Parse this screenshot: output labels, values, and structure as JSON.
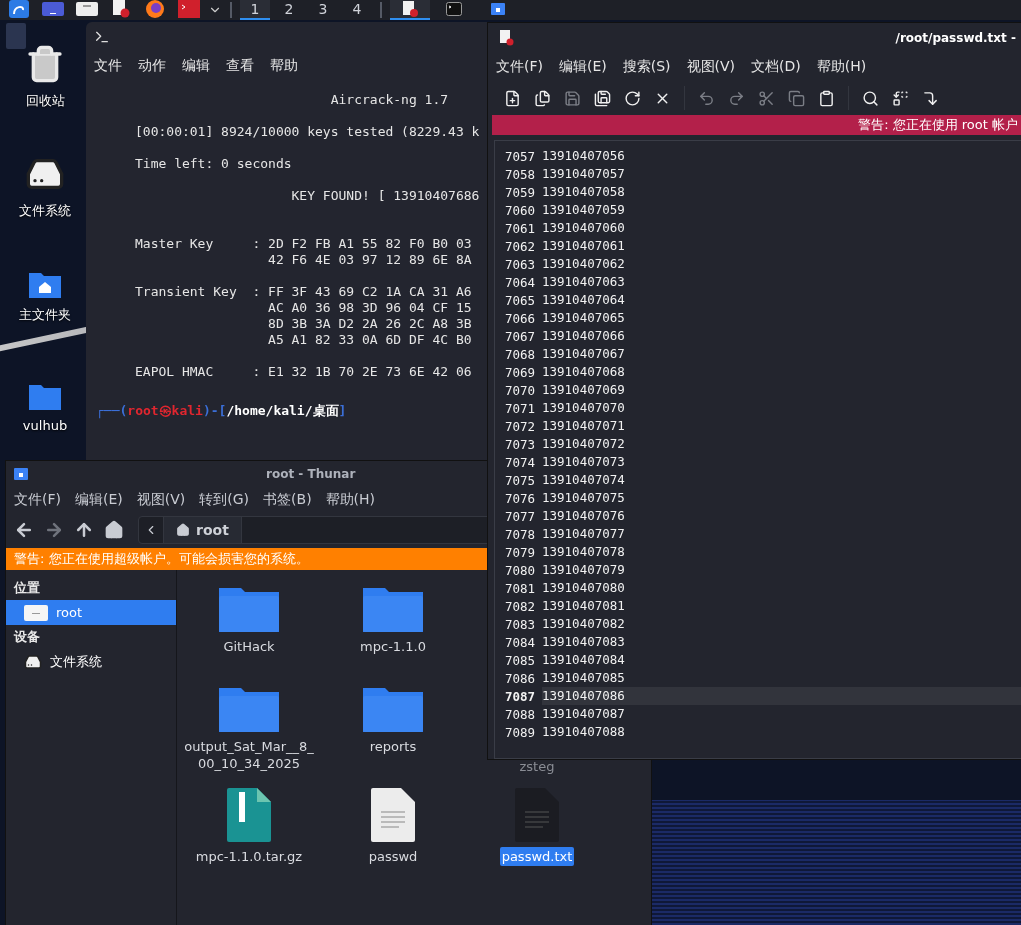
{
  "taskbar": {
    "launchers": [
      {
        "kind": "kali"
      },
      {
        "kind": "window"
      },
      {
        "kind": "folder"
      },
      {
        "kind": "editor"
      },
      {
        "kind": "browser"
      },
      {
        "kind": "terminal"
      }
    ],
    "workspaces": [
      {
        "label": "1",
        "selected": true
      },
      {
        "label": "2",
        "selected": false
      },
      {
        "label": "3",
        "selected": false
      },
      {
        "label": "4",
        "selected": false
      }
    ],
    "tasks": [
      {
        "kind": "editor",
        "selected": true
      },
      {
        "kind": "terminal",
        "selected": false
      },
      {
        "kind": "files",
        "selected": false
      }
    ]
  },
  "desktop": {
    "icons": [
      {
        "kind": "trash",
        "label": "回收站"
      },
      {
        "kind": "drive",
        "label": "文件系统"
      },
      {
        "kind": "home",
        "label": "主文件夹"
      },
      {
        "kind": "folder",
        "label": "vulhub"
      }
    ]
  },
  "terminal": {
    "menu": [
      "文件",
      "动作",
      "编辑",
      "查看",
      "帮助"
    ],
    "output": "                         Aircrack-ng 1.7\n\n[00:00:01] 8924/10000 keys tested (8229.43 k\n\nTime left: 0 seconds\n\n                    KEY FOUND! [ 13910407686\n\n\nMaster Key     : 2D F2 FB A1 55 82 F0 B0 03\n                 42 F6 4E 03 97 12 89 6E 8A\n\nTransient Key  : FF 3F 43 69 C2 1A CA 31 A6\n                 AC A0 36 98 3D 96 04 CF 15\n                 8D 3B 3A D2 2A 26 2C A8 3B\n                 A5 A1 82 33 0A 6D DF 4C B0\n\nEAPOL HMAC     : E1 32 1B 70 2E 73 6E 42 06",
    "prompt": {
      "open": "┌──(",
      "user": "root㉿kali",
      "sep": ")-[",
      "path": "/home/kali/桌面",
      "close": "]"
    }
  },
  "editor": {
    "title": "/root/passwd.txt -",
    "menu": [
      "文件(F)",
      "编辑(E)",
      "搜索(S)",
      "视图(V)",
      "文档(D)",
      "帮助(H)"
    ],
    "toolbar": [
      {
        "kind": "new",
        "disabled": false
      },
      {
        "kind": "open",
        "disabled": false
      },
      {
        "kind": "save",
        "disabled": true
      },
      {
        "kind": "saveas",
        "disabled": false
      },
      {
        "kind": "reload",
        "disabled": false
      },
      {
        "kind": "close",
        "disabled": false
      },
      {
        "kind": "sep"
      },
      {
        "kind": "undo",
        "disabled": true
      },
      {
        "kind": "redo",
        "disabled": true
      },
      {
        "kind": "cut",
        "disabled": true
      },
      {
        "kind": "copy",
        "disabled": true
      },
      {
        "kind": "paste",
        "disabled": false
      },
      {
        "kind": "sep"
      },
      {
        "kind": "find",
        "disabled": false
      },
      {
        "kind": "replace",
        "disabled": false
      },
      {
        "kind": "goto",
        "disabled": false
      }
    ],
    "warning": "警告: 您正在使用 root 帐户",
    "lines": [
      {
        "number": "7057",
        "text": "13910407056",
        "current": false
      },
      {
        "number": "7058",
        "text": "13910407057",
        "current": false
      },
      {
        "number": "7059",
        "text": "13910407058",
        "current": false
      },
      {
        "number": "7060",
        "text": "13910407059",
        "current": false
      },
      {
        "number": "7061",
        "text": "13910407060",
        "current": false
      },
      {
        "number": "7062",
        "text": "13910407061",
        "current": false
      },
      {
        "number": "7063",
        "text": "13910407062",
        "current": false
      },
      {
        "number": "7064",
        "text": "13910407063",
        "current": false
      },
      {
        "number": "7065",
        "text": "13910407064",
        "current": false
      },
      {
        "number": "7066",
        "text": "13910407065",
        "current": false
      },
      {
        "number": "7067",
        "text": "13910407066",
        "current": false
      },
      {
        "number": "7068",
        "text": "13910407067",
        "current": false
      },
      {
        "number": "7069",
        "text": "13910407068",
        "current": false
      },
      {
        "number": "7070",
        "text": "13910407069",
        "current": false
      },
      {
        "number": "7071",
        "text": "13910407070",
        "current": false
      },
      {
        "number": "7072",
        "text": "13910407071",
        "current": false
      },
      {
        "number": "7073",
        "text": "13910407072",
        "current": false
      },
      {
        "number": "7074",
        "text": "13910407073",
        "current": false
      },
      {
        "number": "7075",
        "text": "13910407074",
        "current": false
      },
      {
        "number": "7076",
        "text": "13910407075",
        "current": false
      },
      {
        "number": "7077",
        "text": "13910407076",
        "current": false
      },
      {
        "number": "7078",
        "text": "13910407077",
        "current": false
      },
      {
        "number": "7079",
        "text": "13910407078",
        "current": false
      },
      {
        "number": "7080",
        "text": "13910407079",
        "current": false
      },
      {
        "number": "7081",
        "text": "13910407080",
        "current": false
      },
      {
        "number": "7082",
        "text": "13910407081",
        "current": false
      },
      {
        "number": "7083",
        "text": "13910407082",
        "current": false
      },
      {
        "number": "7084",
        "text": "13910407083",
        "current": false
      },
      {
        "number": "7085",
        "text": "13910407084",
        "current": false
      },
      {
        "number": "7086",
        "text": "13910407085",
        "current": false
      },
      {
        "number": "7087",
        "text": "13910407086",
        "current": true
      },
      {
        "number": "7088",
        "text": "13910407087",
        "current": false
      },
      {
        "number": "7089",
        "text": "13910407088",
        "current": false
      }
    ]
  },
  "file_manager": {
    "title": "root - Thunar",
    "menu": [
      "文件(F)",
      "编辑(E)",
      "视图(V)",
      "转到(G)",
      "书签(B)",
      "帮助(H)"
    ],
    "path": "root",
    "warning": "警告: 您正在使用超级帐户。可能会损害您的系统。",
    "sidebar": [
      {
        "heading": "位置",
        "items": [
          {
            "kind": "folder",
            "label": "root",
            "selected": true
          }
        ]
      },
      {
        "heading": "设备",
        "items": [
          {
            "kind": "drive",
            "label": "文件系统",
            "selected": false
          }
        ]
      }
    ],
    "file_rows": [
      [
        {
          "kind": "folder",
          "name": "GitHack",
          "selected": false
        },
        {
          "kind": "folder",
          "name": "mpc-1.1.0",
          "selected": false
        }
      ],
      [
        {
          "kind": "folder",
          "name": "output_Sat_Mar__8_00_10_34_2025",
          "selected": false
        },
        {
          "kind": "folder",
          "name": "reports",
          "selected": false
        },
        {
          "name": "zsteg",
          "selected": false
        }
      ],
      [
        {
          "kind": "archive",
          "name": "mpc-1.1.0.tar.gz",
          "selected": false
        },
        {
          "kind": "text",
          "name": "passwd",
          "selected": false
        },
        {
          "kind": "textdark",
          "name": "passwd.txt",
          "selected": true
        }
      ]
    ]
  }
}
